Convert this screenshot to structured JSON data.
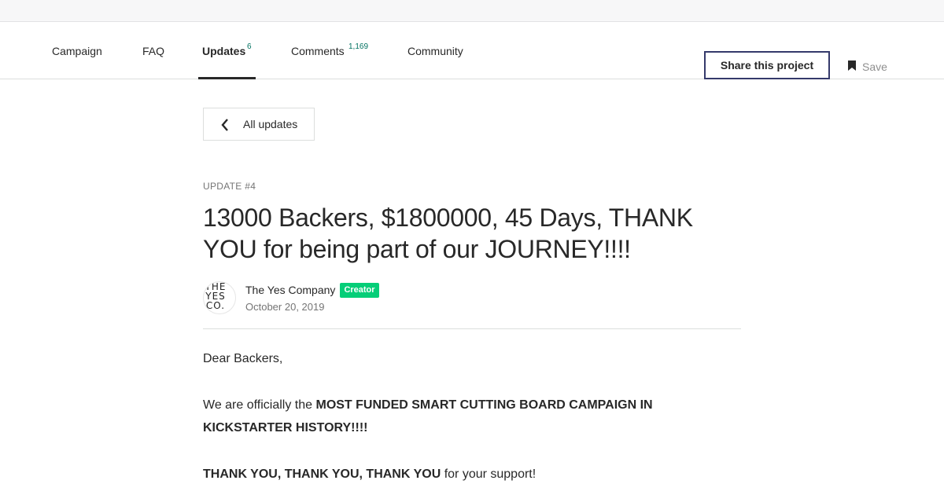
{
  "nav": {
    "tabs": [
      {
        "label": "Campaign",
        "count": ""
      },
      {
        "label": "FAQ",
        "count": ""
      },
      {
        "label": "Updates",
        "count": "6"
      },
      {
        "label": "Comments",
        "count": "1,169"
      },
      {
        "label": "Community",
        "count": ""
      }
    ],
    "active_tab": "Updates",
    "share_label": "Share this project",
    "save_label": "Save"
  },
  "back_button": {
    "label": "All updates",
    "icon": "chevron-left-icon"
  },
  "update": {
    "kicker": "UPDATE #4",
    "title": "13000 Backers, $1800000, 45 Days, THANK YOU for being part of our JOURNEY!!!!",
    "author": "The Yes Company",
    "avatar_text": "THE YES CO.",
    "badge": "Creator",
    "date": "October 20, 2019"
  },
  "content": {
    "greeting": "Dear Backers,",
    "p2_lead": "We are officially the ",
    "p2_bold": "MOST FUNDED SMART CUTTING BOARD CAMPAIGN IN KICKSTARTER HISTORY!!!!",
    "p3_bold": "THANK YOU, THANK YOU, THANK YOU",
    "p3_tail": " for your support!"
  },
  "colors": {
    "accent_green": "#05ce78",
    "count_green": "#037362",
    "share_border": "#353a6b",
    "text": "#282828",
    "muted": "#757575"
  }
}
